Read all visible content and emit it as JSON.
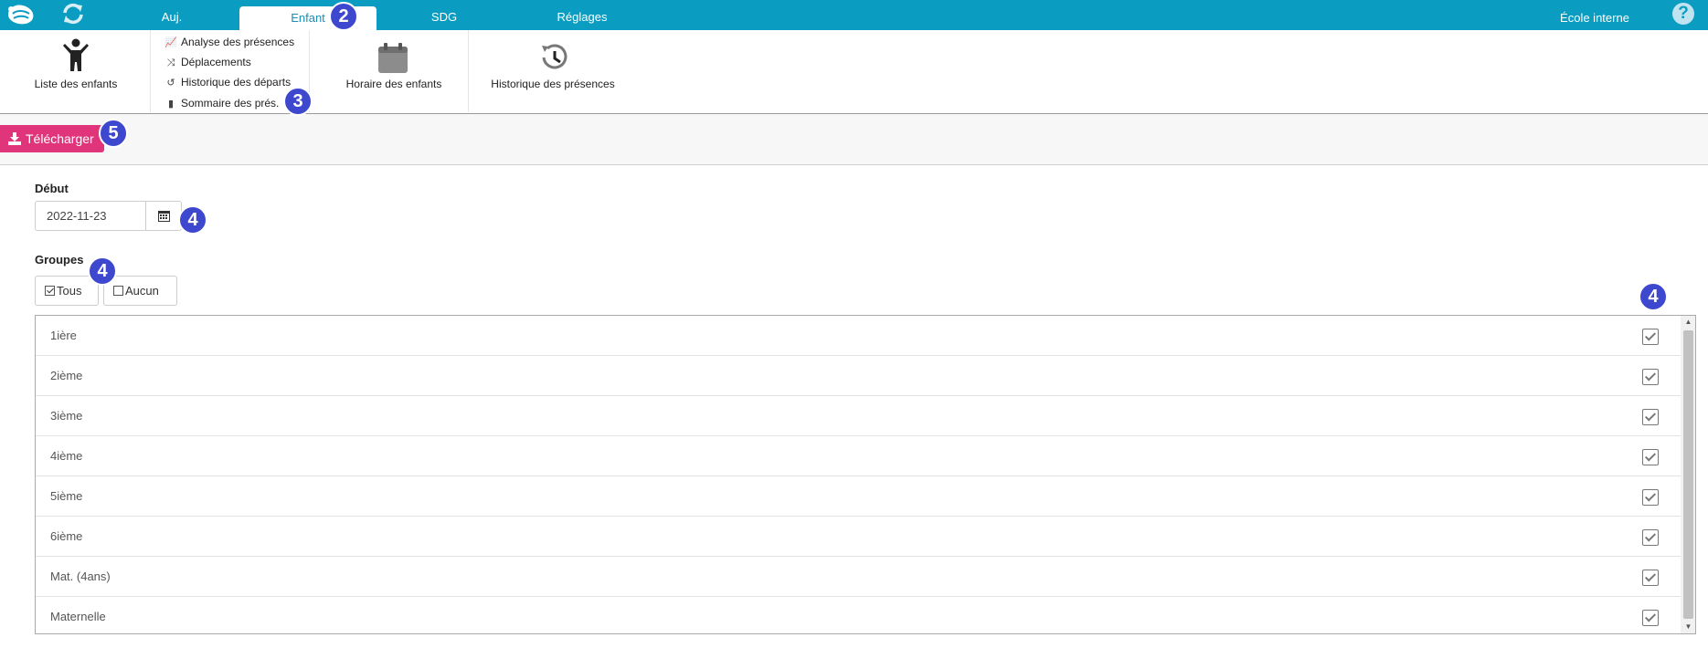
{
  "topbar": {
    "tabs": [
      {
        "label": "Auj."
      },
      {
        "label": "Enfant"
      },
      {
        "label": "SDG"
      },
      {
        "label": "Réglages"
      }
    ],
    "school": "École interne",
    "help": "?"
  },
  "ribbon": {
    "children_list": "Liste des enfants",
    "small_items": [
      {
        "label": "Analyse des présences",
        "icon": "chart-line-icon"
      },
      {
        "label": "Déplacements",
        "icon": "shuffle-icon"
      },
      {
        "label": "Historique des départs",
        "icon": "history-icon"
      },
      {
        "label": "Sommaire des prés.",
        "icon": "book-icon"
      }
    ],
    "schedule": "Horaire des enfants",
    "attendance_history": "Historique des présences"
  },
  "actions": {
    "download": "Télécharger"
  },
  "form": {
    "start_label": "Début",
    "start_value": "2022-11-23",
    "groups_label": "Groupes",
    "all_button": "Tous",
    "none_button": "Aucun"
  },
  "groups": [
    {
      "name": "1ière",
      "checked": true
    },
    {
      "name": "2ième",
      "checked": true
    },
    {
      "name": "3ième",
      "checked": true
    },
    {
      "name": "4ième",
      "checked": true
    },
    {
      "name": "5ième",
      "checked": true
    },
    {
      "name": "6ième",
      "checked": true
    },
    {
      "name": "Mat. (4ans)",
      "checked": true
    },
    {
      "name": "Maternelle",
      "checked": true
    }
  ],
  "callouts": [
    "2",
    "3",
    "5",
    "4",
    "4",
    "4"
  ],
  "colors": {
    "topbar": "#0a9cc1",
    "download_button": "#e0357a",
    "callout": "#3e48cf"
  }
}
